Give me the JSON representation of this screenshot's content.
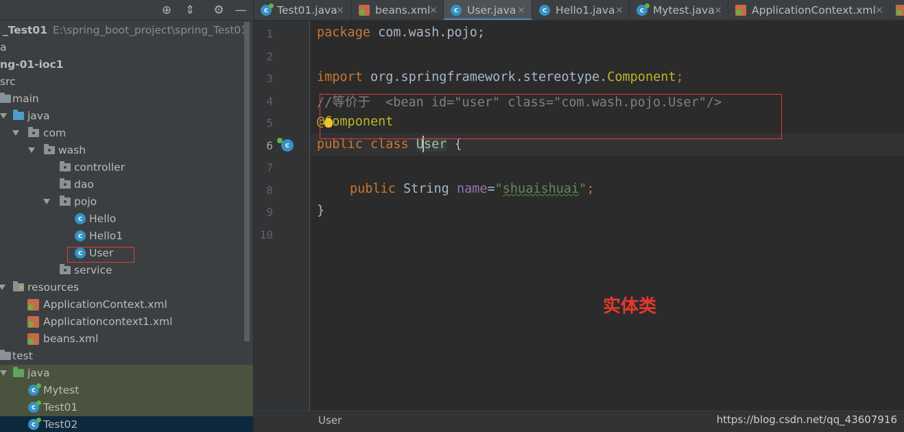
{
  "project_panel": {
    "tree": [
      {
        "label": "_Test01",
        "path": "E:\\spring_boot_project\\spring_Test01"
      },
      {
        "label": "a"
      },
      {
        "label": "ng-01-ioc1"
      },
      {
        "label": "src"
      },
      {
        "label": "main"
      },
      {
        "label": "java"
      },
      {
        "label": "com"
      },
      {
        "label": "wash"
      },
      {
        "label": "controller"
      },
      {
        "label": "dao"
      },
      {
        "label": "pojo"
      },
      {
        "label": "Hello"
      },
      {
        "label": "Hello1"
      },
      {
        "label": "User"
      },
      {
        "label": "service"
      },
      {
        "label": "resources"
      },
      {
        "label": "ApplicationContext.xml"
      },
      {
        "label": "Applicationcontext1.xml"
      },
      {
        "label": "beans.xml"
      },
      {
        "label": "test"
      },
      {
        "label": "java"
      },
      {
        "label": "Mytest"
      },
      {
        "label": "Test01"
      },
      {
        "label": "Test02"
      }
    ]
  },
  "tabs": [
    {
      "label": "Test01.java",
      "icon": "test-class-icon"
    },
    {
      "label": "beans.xml",
      "icon": "xml-file-icon"
    },
    {
      "label": "User.java",
      "icon": "class-icon",
      "active": true
    },
    {
      "label": "Hello1.java",
      "icon": "class-icon"
    },
    {
      "label": "Mytest.java",
      "icon": "test-class-icon"
    },
    {
      "label": "ApplicationContext.xml",
      "icon": "xml-file-icon"
    }
  ],
  "tab_close_glyph": "×",
  "editor": {
    "line_numbers": [
      "1",
      "2",
      "3",
      "4",
      "5",
      "6",
      "7",
      "8",
      "9",
      "10"
    ],
    "current_line": 6,
    "code": {
      "l1_kw": "package",
      "l1_rest": " com.wash.pojo;",
      "l3_kw": "import",
      "l3_pkg": " org.springframework.stereotype.",
      "l3_cls": "Component",
      "l3_semi": ";",
      "l4_comment": "//等价于  <bean id=\"user\" class=\"com.wash.pojo.User\"/>",
      "l5_annotation": "@Component",
      "l6_kw": "public class",
      "l6_name": "User",
      "l6_rest": " {",
      "l8_kw": "public",
      "l8_type": " String ",
      "l8_field": "name",
      "l8_eq": "=",
      "l8_q1": "\"",
      "l8_str": "shuaishuai",
      "l8_q2": "\"",
      "l8_semi": ";",
      "l9": "}"
    },
    "overlay_label": "实体类"
  },
  "breadcrumb": {
    "item": "User"
  },
  "watermark": "https://blog.csdn.net/qq_43607916",
  "colors": {
    "keyword": "#cc7832",
    "annotation": "#bbb529",
    "comment": "#808080",
    "string": "#6a8759",
    "field": "#9876aa",
    "highlight_box": "#e23b3b"
  }
}
